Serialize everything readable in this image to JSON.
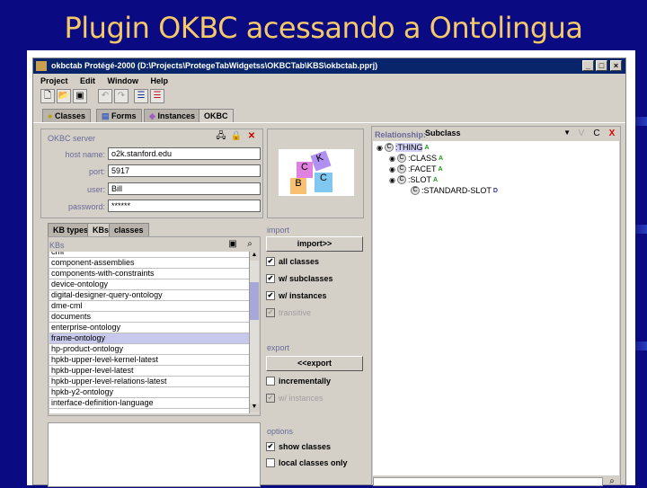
{
  "slide": {
    "title": "Plugin OKBC acessando a Ontolingua"
  },
  "window": {
    "title": "okbctab  Protégé-2000    (D:\\Projects\\ProtegeTabWidgetss\\OKBCTab\\KBS\\okbctab.pprj)"
  },
  "menu": [
    "Project",
    "Edit",
    "Window",
    "Help"
  ],
  "tabs": [
    "Classes",
    "Forms",
    "Instances",
    "OKBC"
  ],
  "server": {
    "label": "OKBC server",
    "fields": [
      {
        "label": "host name:",
        "value": "o2k.stanford.edu"
      },
      {
        "label": "port:",
        "value": "5917"
      },
      {
        "label": "user:",
        "value": "Bill"
      },
      {
        "label": "password:",
        "value": "******"
      }
    ]
  },
  "logo": {
    "letters": [
      "C",
      "K",
      "B",
      "C"
    ]
  },
  "kb_tabs": [
    "KB types",
    "KBs",
    "classes"
  ],
  "kbs": {
    "label": "KBs",
    "items": [
      "cml",
      "component-assemblies",
      "components-with-constraints",
      "device-ontology",
      "digital-designer-query-ontology",
      "dme-cml",
      "documents",
      "enterprise-ontology",
      "frame-ontology",
      "hp-product-ontology",
      "hpkb-upper-level-kernel-latest",
      "hpkb-upper-level-latest",
      "hpkb-upper-level-relations-latest",
      "hpkb-y2-ontology",
      "interface-definition-language"
    ],
    "selected": "frame-ontology"
  },
  "import": {
    "label": "import",
    "button": "import>>",
    "options": [
      {
        "label": "all classes",
        "checked": true,
        "enabled": true
      },
      {
        "label": "w/ subclasses",
        "checked": true,
        "enabled": true
      },
      {
        "label": "w/ instances",
        "checked": true,
        "enabled": true
      },
      {
        "label": "transitive",
        "checked": true,
        "enabled": false
      }
    ]
  },
  "export": {
    "label": "export",
    "button": "<<export",
    "options": [
      {
        "label": "incrementally",
        "checked": false,
        "enabled": true
      },
      {
        "label": "w/ instances",
        "checked": true,
        "enabled": false
      }
    ]
  },
  "options": {
    "label": "options",
    "items": [
      {
        "label": "show classes",
        "checked": true
      },
      {
        "label": "local classes only",
        "checked": false
      }
    ]
  },
  "relationship": {
    "label": "Relationship:",
    "value": "Subclass",
    "buttons": [
      "V",
      "C",
      "X"
    ]
  },
  "tree": [
    {
      "name": ":THING",
      "badge": "A",
      "depth": 0
    },
    {
      "name": ":CLASS",
      "badge": "A",
      "depth": 1
    },
    {
      "name": ":FACET",
      "badge": "A",
      "depth": 1
    },
    {
      "name": ":SLOT",
      "badge": "A",
      "depth": 1
    },
    {
      "name": ":STANDARD-SLOT",
      "badge": "D",
      "depth": 2
    }
  ],
  "colors": {
    "slide_bg": "#0a0a82",
    "title": "#f5c96a",
    "titlebar": "#08246b"
  }
}
